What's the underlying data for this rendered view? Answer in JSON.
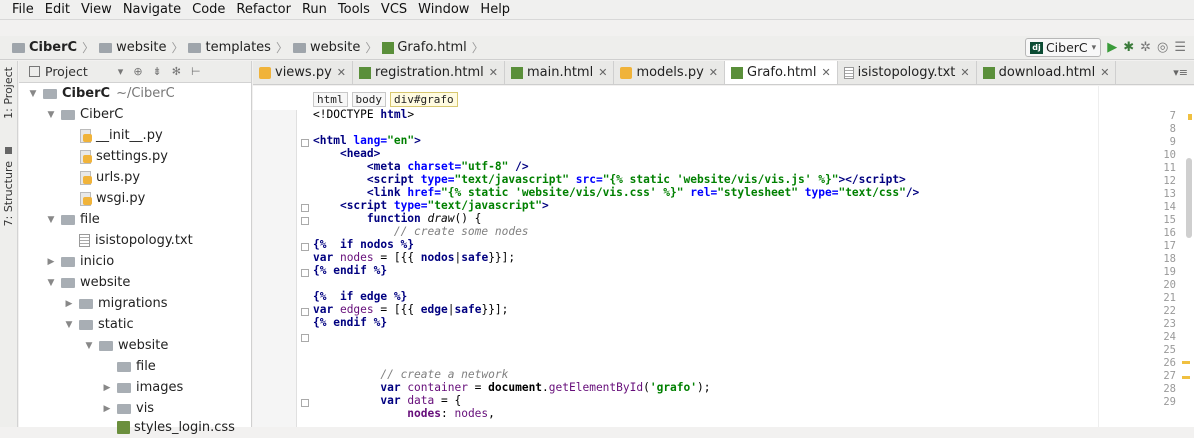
{
  "menu": {
    "items": [
      "File",
      "Edit",
      "View",
      "Navigate",
      "Code",
      "Refactor",
      "Run",
      "Tools",
      "VCS",
      "Window",
      "Help"
    ]
  },
  "navbar": {
    "crumbs": [
      "CiberC",
      "website",
      "templates",
      "website",
      "Grafo.html"
    ]
  },
  "toolbar": {
    "run_config": "CiberC"
  },
  "leftstrip": {
    "project_tab": "1: Project",
    "structure_tab": "7: Structure"
  },
  "project": {
    "header": "Project",
    "root_label": "CiberC",
    "root_path": "~/CiberC",
    "items": [
      {
        "label": "CiberC"
      },
      {
        "label": "__init__.py"
      },
      {
        "label": "settings.py"
      },
      {
        "label": "urls.py"
      },
      {
        "label": "wsgi.py"
      },
      {
        "label": "file"
      },
      {
        "label": "isistopology.txt"
      },
      {
        "label": "inicio"
      },
      {
        "label": "website"
      },
      {
        "label": "migrations"
      },
      {
        "label": "static"
      },
      {
        "label": "website"
      },
      {
        "label": "file"
      },
      {
        "label": "images"
      },
      {
        "label": "vis"
      },
      {
        "label": "styles_login.css"
      }
    ]
  },
  "tabs": [
    {
      "label": "views.py"
    },
    {
      "label": "registration.html"
    },
    {
      "label": "main.html"
    },
    {
      "label": "models.py"
    },
    {
      "label": "Grafo.html"
    },
    {
      "label": "isistopology.txt"
    },
    {
      "label": "download.html"
    }
  ],
  "editor": {
    "breadcrumb_tags": [
      "html",
      "body",
      "div#grafo"
    ],
    "line_numbers": [
      "7",
      "8",
      "9",
      "10",
      "11",
      "12",
      "13",
      "14",
      "15",
      "16",
      "17",
      "18",
      "19",
      "20",
      "21",
      "22",
      "23",
      "24",
      "25",
      "26",
      "27",
      "28",
      "29"
    ]
  }
}
